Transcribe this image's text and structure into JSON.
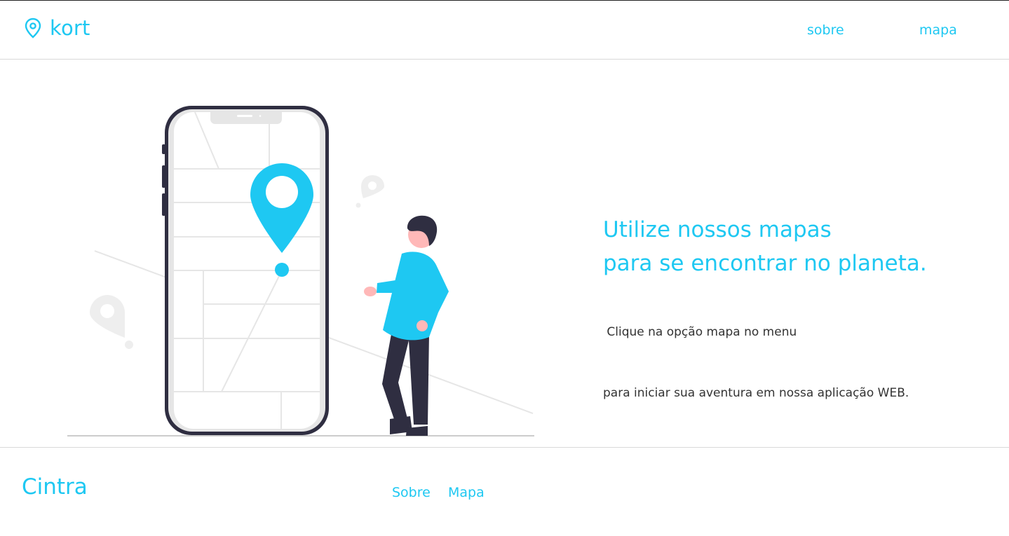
{
  "header": {
    "brand": "kort",
    "nav": [
      {
        "label": "sobre"
      },
      {
        "label": "mapa"
      }
    ]
  },
  "hero": {
    "title_line1": "Utilize nossos mapas",
    "title_line2": "para se encontrar no planeta.",
    "subtitle_line1": " Clique na opção mapa no menu",
    "subtitle_line2": "para iniciar sua aventura em nossa aplicação WEB."
  },
  "footer": {
    "brand": "Cintra",
    "links": [
      {
        "label": "Sobre"
      },
      {
        "label": "Mapa"
      }
    ]
  },
  "colors": {
    "accent": "#1ec8f2",
    "text": "#333333",
    "dark": "#2f2e41"
  },
  "icons": {
    "brand": "map-pin-icon"
  }
}
